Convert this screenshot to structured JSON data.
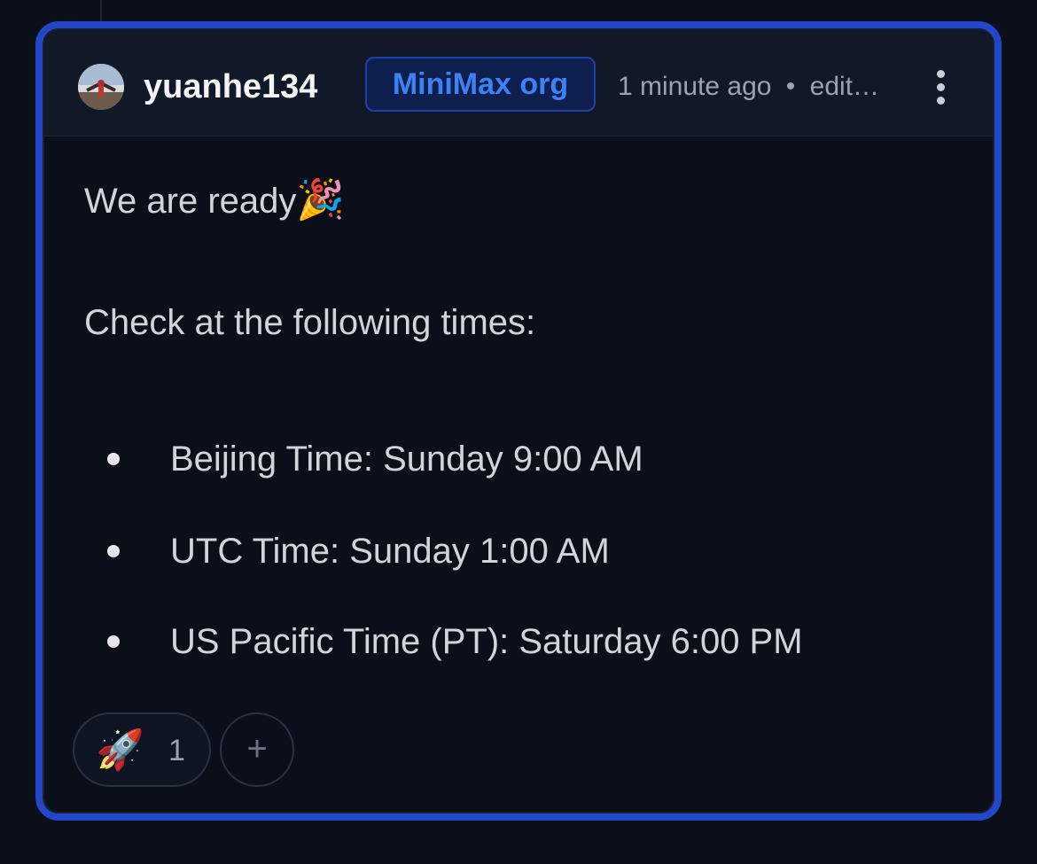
{
  "comment": {
    "username": "yuanhe134",
    "org_badge": "MiniMax org",
    "timestamp": "1 minute ago",
    "separator": "•",
    "edited": "edit…",
    "body": {
      "line1": "We are ready",
      "line1_emoji": "🎉",
      "line2": "Check at the following times:",
      "items": [
        "Beijing Time: Sunday 9:00 AM",
        "UTC Time: Sunday 1:00 AM",
        "US Pacific Time (PT): Saturday 6:00 PM"
      ]
    },
    "reactions": [
      {
        "emoji": "🚀",
        "count": "1"
      }
    ],
    "add_reaction_label": "+"
  },
  "icons": {
    "menu": "more-vertical-icon",
    "avatar": "user-avatar"
  },
  "colors": {
    "background": "#0b0f19",
    "highlight_border": "#2446c9",
    "org_badge_text": "#3b82f6",
    "text": "#d1d5db"
  }
}
